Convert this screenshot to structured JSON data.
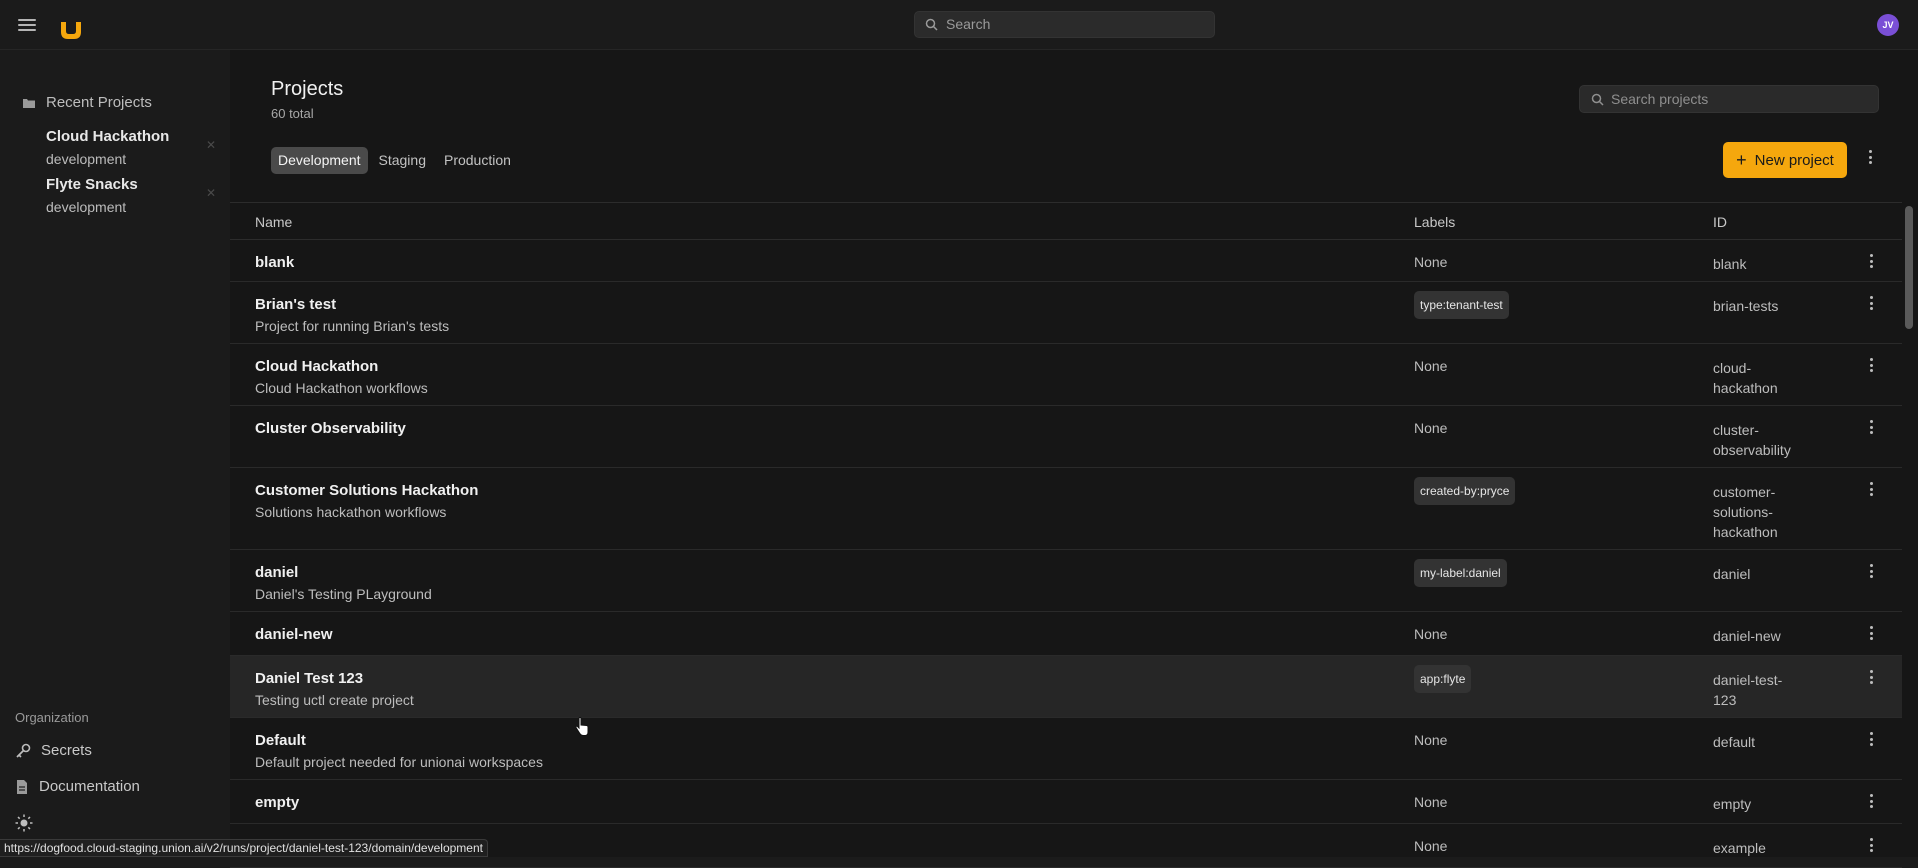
{
  "topbar": {
    "search_placeholder": "Search",
    "avatar_initials": "JV"
  },
  "sidebar": {
    "recent_heading": "Recent Projects",
    "recent": [
      {
        "title": "Cloud Hackathon",
        "domain": "development"
      },
      {
        "title": "Flyte Snacks",
        "domain": "development"
      }
    ],
    "org_label": "Organization",
    "links": [
      {
        "label": "Secrets",
        "icon": "key-icon"
      },
      {
        "label": "Documentation",
        "icon": "document-icon"
      }
    ]
  },
  "main": {
    "title": "Projects",
    "total": "60 total",
    "search_placeholder": "Search projects",
    "tabs": [
      "Development",
      "Staging",
      "Production"
    ],
    "active_tab": "Development",
    "new_button": "New project"
  },
  "table": {
    "columns": [
      "Name",
      "Labels",
      "ID"
    ],
    "rows": [
      {
        "name": "blank",
        "desc": "",
        "labels": "None",
        "chip": false,
        "id_lines": [
          "blank"
        ]
      },
      {
        "name": "Brian's test",
        "desc": "Project for running Brian's tests",
        "labels": "type:tenant-test",
        "chip": true,
        "id_lines": [
          "brian-tests"
        ]
      },
      {
        "name": "Cloud Hackathon",
        "desc": "Cloud Hackathon workflows",
        "labels": "None",
        "chip": false,
        "id_lines": [
          "cloud-",
          "hackathon"
        ]
      },
      {
        "name": "Cluster Observability",
        "desc": "",
        "labels": "None",
        "chip": false,
        "id_lines": [
          "cluster-",
          "observability"
        ]
      },
      {
        "name": "Customer Solutions Hackathon",
        "desc": "Solutions hackathon workflows",
        "labels": "created-by:pryce",
        "chip": true,
        "id_lines": [
          "customer-",
          "solutions-",
          "hackathon"
        ]
      },
      {
        "name": "daniel",
        "desc": "Daniel's Testing PLayground",
        "labels": "my-label:daniel",
        "chip": true,
        "id_lines": [
          "daniel"
        ]
      },
      {
        "name": "daniel-new",
        "desc": "",
        "labels": "None",
        "chip": false,
        "id_lines": [
          "daniel-new"
        ]
      },
      {
        "name": "Daniel Test 123",
        "desc": "Testing uctl create project",
        "labels": "app:flyte",
        "chip": true,
        "id_lines": [
          "daniel-test-",
          "123"
        ]
      },
      {
        "name": "Default",
        "desc": "Default project needed for unionai workspaces",
        "labels": "None",
        "chip": false,
        "id_lines": [
          "default"
        ]
      },
      {
        "name": "empty",
        "desc": "",
        "labels": "None",
        "chip": false,
        "id_lines": [
          "empty"
        ]
      },
      {
        "name": "",
        "desc": "",
        "labels": "None",
        "chip": false,
        "id_lines": [
          "example"
        ]
      }
    ]
  },
  "statusbar": {
    "url": "https://dogfood.cloud-staging.union.ai/v2/runs/project/daniel-test-123/domain/development"
  },
  "colors": {
    "accent": "#f5a70d",
    "background": "#161616",
    "sidebar": "#1b1b1b",
    "avatar": "#7a4fd6"
  }
}
